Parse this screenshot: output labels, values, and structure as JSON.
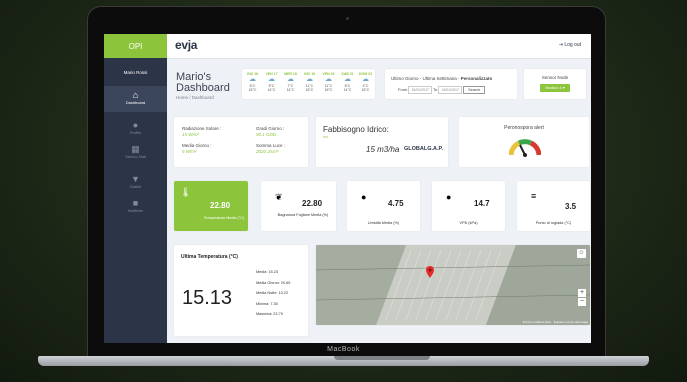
{
  "device_label": "MacBook",
  "sidebar": {
    "logo": "OPI",
    "user": "Mario Rossi",
    "items": [
      {
        "label": "Dashboard",
        "icon": "home-icon"
      },
      {
        "label": "Profilo",
        "icon": "user-icon"
      },
      {
        "label": "Storico Dati",
        "icon": "calendar-icon"
      },
      {
        "label": "Grafici",
        "icon": "filter-icon"
      },
      {
        "label": "Notifiche",
        "icon": "bell-icon"
      }
    ]
  },
  "topbar": {
    "brand": "evja",
    "logout": "Log out"
  },
  "header": {
    "title_line1": "Mario's",
    "title_line2": "Dashboard",
    "breadcrumb": "Home / Dashboard"
  },
  "forecast": [
    {
      "day": "GIO 16",
      "max": "6°C",
      "min": "15°C"
    },
    {
      "day": "VEN 17",
      "max": "5°C",
      "min": "14°C"
    },
    {
      "day": "MER 18",
      "max": "7°C",
      "min": "14°C"
    },
    {
      "day": "GIO 19",
      "max": "11°C",
      "min": "15°C"
    },
    {
      "day": "VEN 20",
      "max": "11°C",
      "min": "18°C"
    },
    {
      "day": "SAB 21",
      "max": "8°C",
      "min": "14°C"
    },
    {
      "day": "DOM 22",
      "max": "4°C",
      "min": "15°C"
    }
  ],
  "period": {
    "label_prefix": "Ultimo Giorno - Ultima Settimana - ",
    "label_bold": "Personalizzato",
    "from_label": "From",
    "from_value": "15/01/2017",
    "to_label": "To",
    "to_value": "19/01/2017",
    "search": "Search"
  },
  "sensor": {
    "label": "Sensor Node",
    "value": "Modulo 4"
  },
  "radiation": {
    "rad_label": "Radiazione Solare :",
    "rad_value": "15 W/m²",
    "gradi_label": "Gradi Giorno :",
    "gradi_value": "90.1 GDD",
    "media_label": "Media Giorno :",
    "media_value": "5 W/m²",
    "luce_label": "Somma Luce :",
    "luce_value": "2020 J/cm²"
  },
  "water": {
    "title": "Fabbisogno Idrico:",
    "sub": "ieri",
    "value": "15 m3/ha",
    "brand": "GLOBALG.A.P."
  },
  "peronospora": {
    "title": "Peronospora alert"
  },
  "kpis": [
    {
      "value": "22.80",
      "label": "Temperatura Media (°C)",
      "icon": "thermometer-icon"
    },
    {
      "value": "22.80",
      "label": "Bagnatura Fogliare Media (%)",
      "icon": "leaf-icon"
    },
    {
      "value": "4.75",
      "label": "Umidità Media (%)",
      "icon": "drop-icon"
    },
    {
      "value": "14.7",
      "label": "VPD (kPa)",
      "icon": "drops-icon"
    },
    {
      "value": "3.5",
      "label": "Punto di rugiada (°C)",
      "icon": "fog-icon"
    }
  ],
  "last_temp": {
    "title": "Ultima Temperatura (°C)",
    "value": "15.13",
    "stats": [
      "Media: 15.23",
      "Media Giorno: 20.65",
      "Media Notte: 10.22",
      "Minima: 7.35",
      "Massima: 23.79"
    ]
  },
  "map": {
    "zoom_in": "+",
    "zoom_out": "−",
    "footer": "Termini e condizioni d'uso    Segnala un errore nella mappa"
  },
  "colors": {
    "accent": "#8cc43c",
    "sidebar": "#2c3547"
  }
}
